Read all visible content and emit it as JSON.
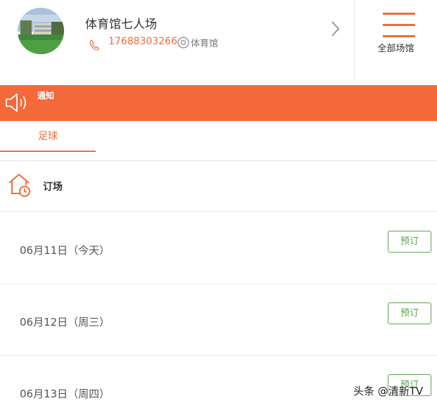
{
  "header": {
    "venue_name": "体育馆七人场",
    "phone": "17688303266",
    "location": "体育馆",
    "menu_label": "全部场馆"
  },
  "notice": {
    "label": "通知"
  },
  "tabs": [
    {
      "label": "足球",
      "active": true
    }
  ],
  "booking": {
    "title": "订场",
    "days": [
      {
        "date": "06月11日（今天）",
        "button": "预订"
      },
      {
        "date": "06月12日（周三）",
        "button": "预订"
      },
      {
        "date": "06月13日（周四）",
        "button": "预订"
      }
    ]
  },
  "watermark": "头条 @清新TV",
  "colors": {
    "accent": "#f4693a",
    "book_green": "#5aa64a"
  }
}
